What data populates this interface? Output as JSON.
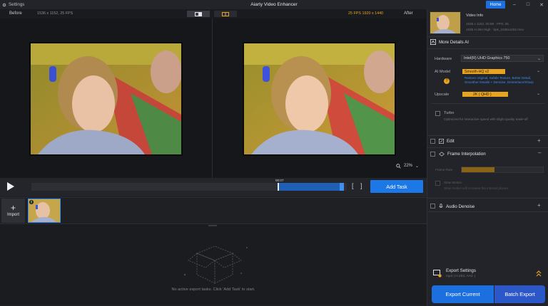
{
  "titlebar": {
    "settings_label": "Settings",
    "app_title": "Aiarty Video Enhancer",
    "home_label": "Home"
  },
  "preview": {
    "before_label": "Before",
    "before_info": "1536 x 1152, 25 FPS",
    "after_label": "After",
    "after_info": "25 FPS 1920 x 1440",
    "zoom_value": "22%"
  },
  "timeline": {
    "timecode": "00:07",
    "progress": 0.78,
    "add_task_label": "Add Task"
  },
  "media": {
    "import_label": "Import",
    "thumb_badge": "0"
  },
  "tasks": {
    "empty_message": "No active export tasks. Click 'Add Task' to start."
  },
  "panel": {
    "video_info_title": "Video Info",
    "video_meta_1": "1536 x 1152, 00:08 · FPS: 25",
    "video_meta_2": "1536 H.264 High · bps_1536x1152.mov",
    "more_details_title": "More Details AI",
    "hardware_label": "Hardware",
    "hardware_value": "Intel(R) UHD Graphics 750",
    "ai_model_label": "AI Model",
    "ai_model_value": "Smooth-HQ v2",
    "ai_model_desc": "Restore original, Subtle Texture, Better Detail, Smoother Details + Denoise, Deinterlace/Sharp",
    "upscale_label": "Upscale",
    "upscale_value": "2K ( QHD )",
    "turbo_label": "Turbo",
    "turbo_desc": "Optimized for interactive speed with slight quality trade-off",
    "edit_label": "Edit",
    "frame_interp_label": "Frame Interpolation",
    "frame_rate_label": "Frame Rate",
    "slow_motion_label": "Slow Motion",
    "slow_motion_desc": "Slow motion will increase the interval picture",
    "audio_denoise_label": "Audio Denoise",
    "export_settings_label": "Export Settings",
    "export_settings_sub": "mp4 | H.264, AAC |",
    "export_current_label": "Export Current",
    "batch_export_label": "Batch Export"
  },
  "colors": {
    "accent": "#1b6fde",
    "orange": "#e8a321",
    "background": "#1e1f23"
  }
}
